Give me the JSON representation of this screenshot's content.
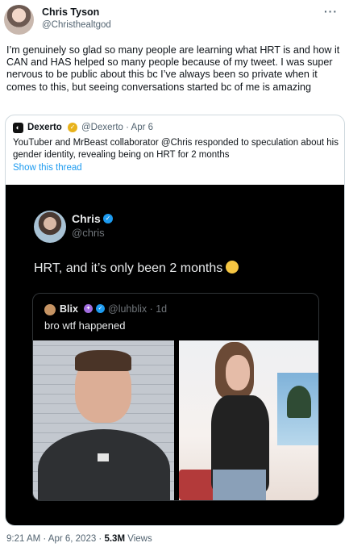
{
  "tweet": {
    "author_name": "Chris Tyson",
    "author_handle": "@Christhealtgod",
    "more_label": "···",
    "text": "I’m genuinely so glad so many people are learning what HRT is and how it CAN and HAS helped so many people because of my tweet. I was super nervous to be public about this bc I’ve always been so private when it comes to this, but seeing conversations started bc of me is amazing",
    "time": "9:21 AM · Apr 6, 2023 · ",
    "views_count": "5.3M",
    "views_label": " Views"
  },
  "quote": {
    "logo_glyph": "◐",
    "author_name": "Dexerto",
    "badge_glyph": "✓",
    "handle_date": "@Dexerto · Apr 6",
    "text": "YouTuber and MrBeast collaborator @Chris responded to speculation about his gender identity, revealing being on HRT for 2 months",
    "show_thread": "Show this thread"
  },
  "media": {
    "author_name": "Chris",
    "verified_glyph": "✓",
    "author_handle": "@chris",
    "text": "HRT, and it’s only been 2 months",
    "inner": {
      "author_name": "Blix",
      "badge1_glyph": "✦",
      "badge2_glyph": "✓",
      "handle_date": "@luhblix · 1d",
      "text": "bro wtf happened"
    }
  },
  "colors": {
    "link": "#1d9bf0",
    "secondary_text": "#536471",
    "media_background": "#000000"
  }
}
